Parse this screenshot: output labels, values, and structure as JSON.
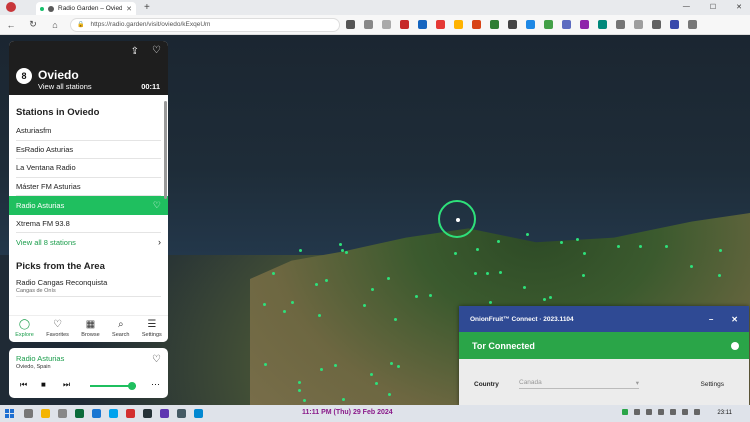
{
  "browser": {
    "tab_title": "Radio Garden – Oviedo",
    "url": "https://radio.garden/visit/oviedo/kExqeUm"
  },
  "panel": {
    "count_badge": "8",
    "city": "Oviedo",
    "view_all": "View all stations",
    "timer": "00:11",
    "section_stations": "Stations in Oviedo",
    "stations": [
      "Asturiasfm",
      "EsRadio Asturias",
      "La Ventana Radio",
      "Máster FM Asturias",
      "Radio Asturias",
      "Xtrema FM 93.8"
    ],
    "active_station_index": 4,
    "view_all_count": "View all 8 stations",
    "section_picks": "Picks from the Area",
    "picks": [
      {
        "name": "Radio Cangas Reconquista",
        "place": "Cangas de Onís"
      }
    ]
  },
  "bottom_nav": [
    "Explore",
    "Favorites",
    "Browse",
    "Search",
    "Settings"
  ],
  "player": {
    "station": "Radio Asturias",
    "location": "Oviedo, Spain",
    "volume_fraction": 0.9
  },
  "onionfruit": {
    "title": "OnionFruit™ Connect · 2023.1104",
    "status": "Tor Connected",
    "country_label": "Country",
    "country_value": "Canada",
    "settings": "Settings"
  },
  "taskbar": {
    "datetime": "11:11 PM (Thu) 29 Feb 2024",
    "clock": "23:11"
  },
  "colors": {
    "accent_green": "#1fbf5f",
    "onion_blue": "#2f4a94",
    "tor_green": "#2aa548"
  }
}
